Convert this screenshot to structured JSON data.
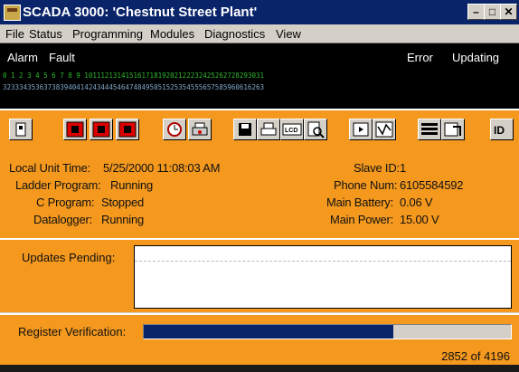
{
  "window": {
    "title": "SCADA 3000: 'Chestnut Street Plant'",
    "controls": {
      "minimize": "–",
      "maximize": "□",
      "close": "✕"
    }
  },
  "menu": [
    "File",
    "Status",
    "Programming",
    "Modules",
    "Diagnostics",
    "View"
  ],
  "status_bar": {
    "alarm": "Alarm",
    "fault": "Fault",
    "error": "Error",
    "updating": "Updating",
    "channels_row1": "0 1 2 3 4 5 6 7 8 9 10111213141516171819202122232425262728293031",
    "channels_row2": "3233343536373839404142434445464748495051525354555657585960616263"
  },
  "toolbar_icons": [
    "run-icon",
    "stop-red-icon",
    "stop-red-icon",
    "stop-red-icon",
    "clock-icon",
    "printer-icon",
    "save-icon",
    "print-icon",
    "lcd-icon",
    "search-icon",
    "window-icon",
    "graph-icon",
    "list-icon",
    "id-icon"
  ],
  "info": {
    "local_time_label": "Local Unit Time:",
    "local_time_value": "5/25/2000 11:08:03 AM",
    "ladder_label": "Ladder Program:",
    "ladder_value": "Running",
    "cprog_label": "C Program:",
    "cprog_value": "Stopped",
    "logger_label": "Datalogger:",
    "logger_value": "Running",
    "slave_label": "Slave ID:",
    "slave_value": "1",
    "phone_label": "Phone Num:",
    "phone_value": "6105584592",
    "battery_label": "Main Battery:",
    "battery_value": "0.06 V",
    "power_label": "Main Power:",
    "power_value": "15.00 V"
  },
  "updates": {
    "label": "Updates Pending:"
  },
  "verification": {
    "label": "Register Verification:",
    "count": "2852 of 4196",
    "progress_fraction": 0.68
  },
  "colors": {
    "panel": "#f4981e",
    "title": "#0a246a",
    "progress": "#0a246a"
  }
}
